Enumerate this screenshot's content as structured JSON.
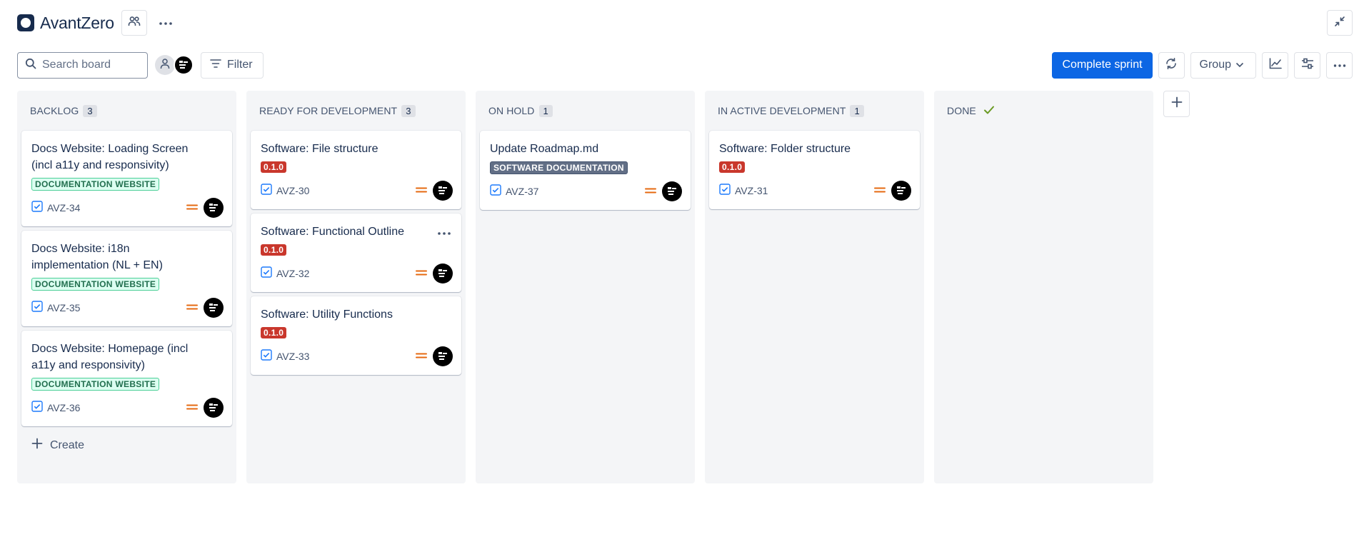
{
  "header": {
    "project_name": "AvantZero",
    "icons": [
      "project-logo-icon",
      "people-icon",
      "more-icon",
      "minimize-icon"
    ]
  },
  "toolbar": {
    "search_placeholder": "Search board",
    "filter_label": "Filter",
    "complete_sprint_label": "Complete sprint",
    "group_label": "Group",
    "accent_color": "#0c66e4"
  },
  "columns": [
    {
      "name": "BACKLOG",
      "count": "3",
      "cards": [
        {
          "title": "Docs Website: Loading Screen (incl a11y and responsivity)",
          "label": "DOCUMENTATION WEBSITE",
          "key": "AVZ-34"
        },
        {
          "title": "Docs Website: i18n implementation (NL + EN)",
          "label": "DOCUMENTATION WEBSITE",
          "key": "AVZ-35"
        },
        {
          "title": "Docs Website: Homepage (incl a11y and responsivity)",
          "label": "DOCUMENTATION WEBSITE",
          "key": "AVZ-36"
        }
      ],
      "create_label": "Create"
    },
    {
      "name": "READY FOR DEVELOPMENT",
      "count": "3",
      "cards": [
        {
          "title": "Software: File structure",
          "label": "0.1.0",
          "key": "AVZ-30"
        },
        {
          "title": "Software: Functional Outline",
          "label": "0.1.0",
          "key": "AVZ-32"
        },
        {
          "title": "Software: Utility Functions",
          "label": "0.1.0",
          "key": "AVZ-33"
        }
      ]
    },
    {
      "name": "ON HOLD",
      "count": "1",
      "cards": [
        {
          "title": "Update Roadmap.md",
          "label": "SOFTWARE DOCUMENTATION",
          "key": "AVZ-37"
        }
      ]
    },
    {
      "name": "IN ACTIVE DEVELOPMENT",
      "count": "1",
      "cards": [
        {
          "title": "Software: Folder structure",
          "label": "0.1.0",
          "key": "AVZ-31"
        }
      ]
    },
    {
      "name": "DONE",
      "count": "",
      "cards": []
    }
  ],
  "colors": {
    "lozenge_green": "#216e4e",
    "lozenge_red": "#c9372c",
    "lozenge_gray": "#626f86",
    "priority_medium": "#e56910",
    "done_check": "#6a9a23"
  }
}
